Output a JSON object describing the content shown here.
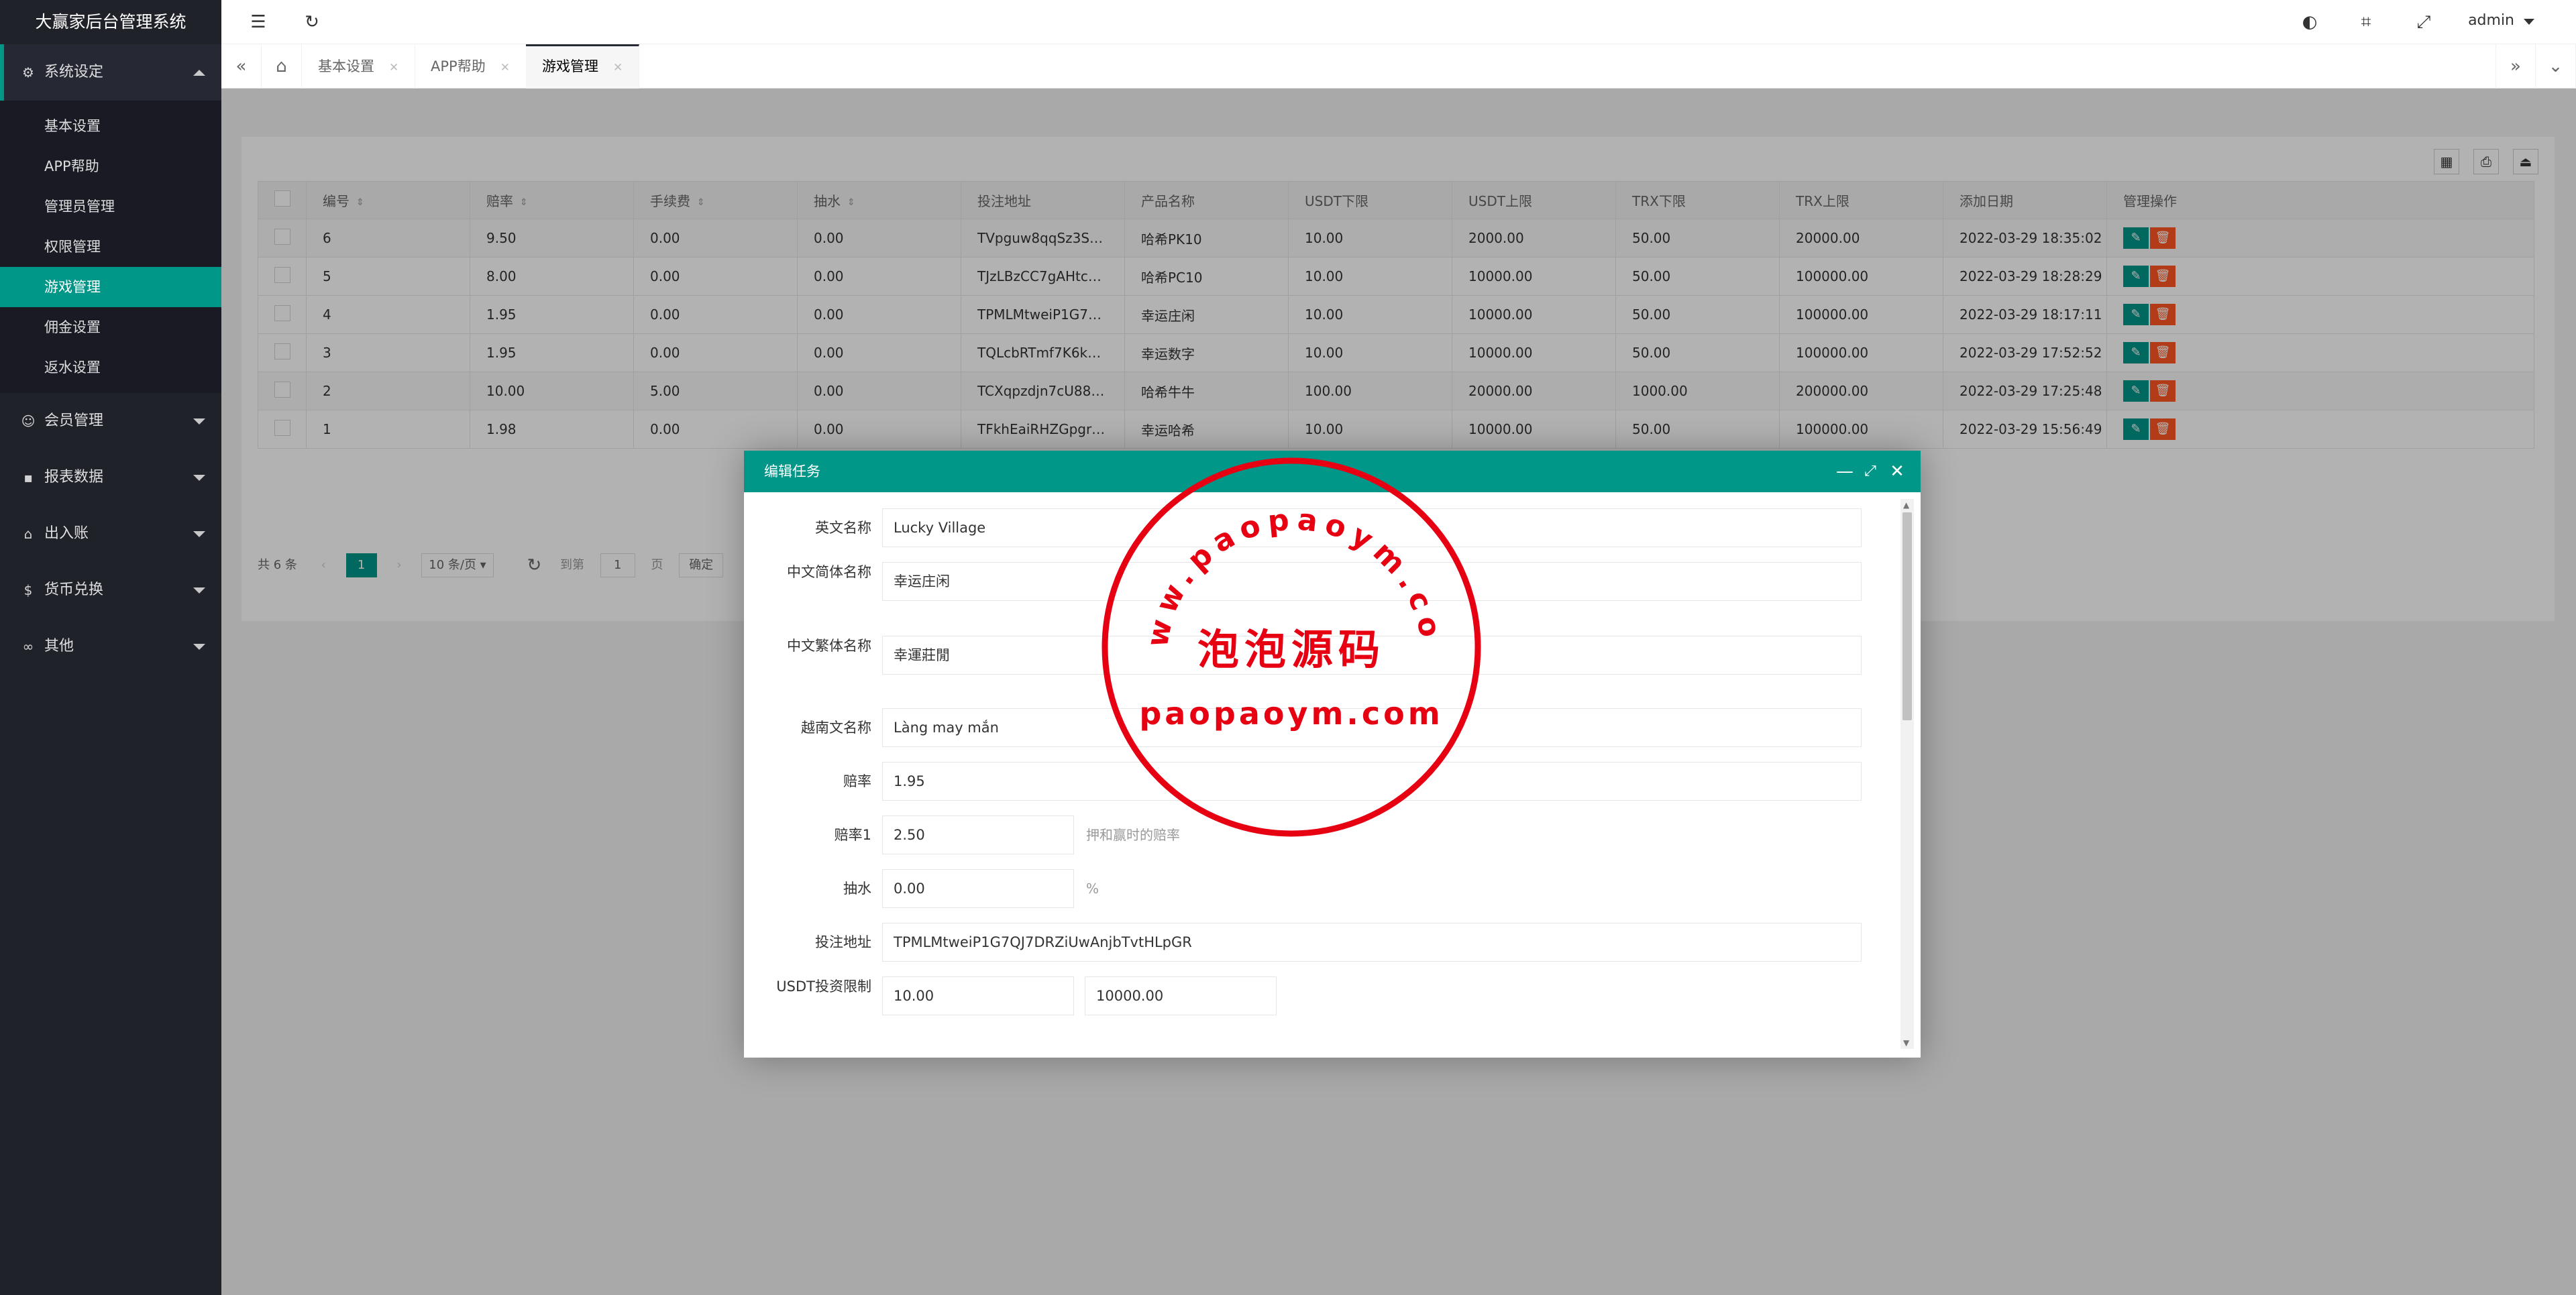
{
  "app": {
    "title": "大赢家后台管理系统"
  },
  "sidebar": {
    "groups": [
      {
        "label": "系统设定",
        "icon": "gear-icon"
      },
      {
        "label": "会员管理",
        "icon": "user-icon"
      },
      {
        "label": "报表数据",
        "icon": "chat-icon"
      },
      {
        "label": "出入账",
        "icon": "bank-icon"
      },
      {
        "label": "货币兑换",
        "icon": "currency-icon"
      },
      {
        "label": "其他",
        "icon": "link-icon"
      }
    ],
    "sub_items": [
      {
        "label": "基本设置"
      },
      {
        "label": "APP帮助"
      },
      {
        "label": "管理员管理"
      },
      {
        "label": "权限管理"
      },
      {
        "label": "游戏管理"
      },
      {
        "label": "佣金设置"
      },
      {
        "label": "返水设置"
      }
    ]
  },
  "header": {
    "user": "admin"
  },
  "tabs": [
    {
      "label": "基本设置"
    },
    {
      "label": "APP帮助"
    },
    {
      "label": "游戏管理"
    }
  ],
  "table": {
    "columns": [
      "编号",
      "赔率",
      "手续费",
      "抽水",
      "投注地址",
      "产品名称",
      "USDT下限",
      "USDT上限",
      "TRX下限",
      "TRX上限",
      "添加日期",
      "管理操作"
    ],
    "rows": [
      [
        "6",
        "9.50",
        "0.00",
        "0.00",
        "TVpguw8qqSz3S…",
        "哈希PK10",
        "10.00",
        "2000.00",
        "50.00",
        "20000.00",
        "2022-03-29 18:35:02"
      ],
      [
        "5",
        "8.00",
        "0.00",
        "0.00",
        "TJzLBzCC7gAHtc…",
        "哈希PC10",
        "10.00",
        "10000.00",
        "50.00",
        "100000.00",
        "2022-03-29 18:28:29"
      ],
      [
        "4",
        "1.95",
        "0.00",
        "0.00",
        "TPMLMtweiP1G7…",
        "幸运庄闲",
        "10.00",
        "10000.00",
        "50.00",
        "100000.00",
        "2022-03-29 18:17:11"
      ],
      [
        "3",
        "1.95",
        "0.00",
        "0.00",
        "TQLcbRTmf7K6k…",
        "幸运数字",
        "10.00",
        "10000.00",
        "50.00",
        "100000.00",
        "2022-03-29 17:52:52"
      ],
      [
        "2",
        "10.00",
        "5.00",
        "0.00",
        "TCXqpzdjn7cU88…",
        "哈希牛牛",
        "100.00",
        "20000.00",
        "1000.00",
        "200000.00",
        "2022-03-29 17:25:48"
      ],
      [
        "1",
        "1.98",
        "0.00",
        "0.00",
        "TFkhEaiRHZGpgr…",
        "幸运哈希",
        "10.00",
        "10000.00",
        "50.00",
        "100000.00",
        "2022-03-29 15:56:49"
      ]
    ]
  },
  "pager": {
    "total": "共 6 条",
    "current": "1",
    "per_page": "10 条/页",
    "goto_prefix": "到第",
    "goto_value": "1",
    "goto_suffix": "页",
    "confirm": "确定"
  },
  "modal": {
    "title": "编辑任务",
    "fields": [
      {
        "label": "英文名称",
        "value": "Lucky Village"
      },
      {
        "label": "中文简体名称",
        "value": "幸运庄闲"
      },
      {
        "label": "中文繁体名称",
        "value": "幸運莊閒"
      },
      {
        "label": "越南文名称",
        "value": "Làng may mắn"
      },
      {
        "label": "赔率",
        "value": "1.95"
      },
      {
        "label": "赔率1",
        "value": "2.50",
        "hint": "押和赢时的赔率"
      },
      {
        "label": "抽水",
        "value": "0.00",
        "hint": "%"
      },
      {
        "label": "投注地址",
        "value": "TPMLMtweiP1G7QJ7DRZiUwAnjbTvtHLpGR"
      },
      {
        "label": "USDT投资限制",
        "value": "10.00",
        "value2": "10000.00"
      }
    ]
  },
  "watermark": {
    "arc_text": "www.paopaoym.com",
    "main_text": "泡泡源码",
    "bottom_text": "paopaoym.com",
    "color": "#e60012"
  },
  "colors": {
    "accent": "#009688",
    "danger": "#ff5722",
    "sidebar": "#20222a"
  }
}
